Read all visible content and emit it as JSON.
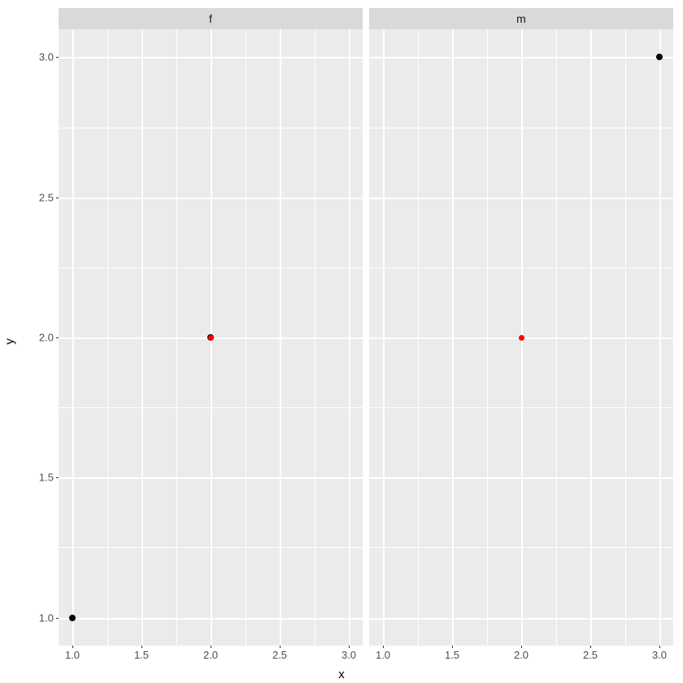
{
  "chart_data": {
    "type": "scatter",
    "xlabel": "x",
    "ylabel": "y",
    "xlim": [
      0.9,
      3.1
    ],
    "ylim": [
      0.9,
      3.1
    ],
    "x_ticks_major": [
      1.0,
      1.5,
      2.0,
      2.5,
      3.0
    ],
    "y_ticks_major": [
      1.0,
      1.5,
      2.0,
      2.5,
      3.0
    ],
    "facets": [
      {
        "label": "f",
        "points": [
          {
            "x": 1.0,
            "y": 1.0,
            "color": "black"
          },
          {
            "x": 2.0,
            "y": 2.0,
            "color": "black"
          },
          {
            "x": 2.0,
            "y": 2.0,
            "color": "red"
          }
        ]
      },
      {
        "label": "m",
        "points": [
          {
            "x": 2.0,
            "y": 2.0,
            "color": "red"
          },
          {
            "x": 3.0,
            "y": 3.0,
            "color": "black"
          }
        ]
      }
    ],
    "facet_labels": {
      "f": "f",
      "m": "m"
    }
  },
  "tick_labels": {
    "x": [
      "1.0",
      "1.5",
      "2.0",
      "2.5",
      "3.0"
    ],
    "y": [
      "1.0",
      "1.5",
      "2.0",
      "2.5",
      "3.0"
    ]
  }
}
